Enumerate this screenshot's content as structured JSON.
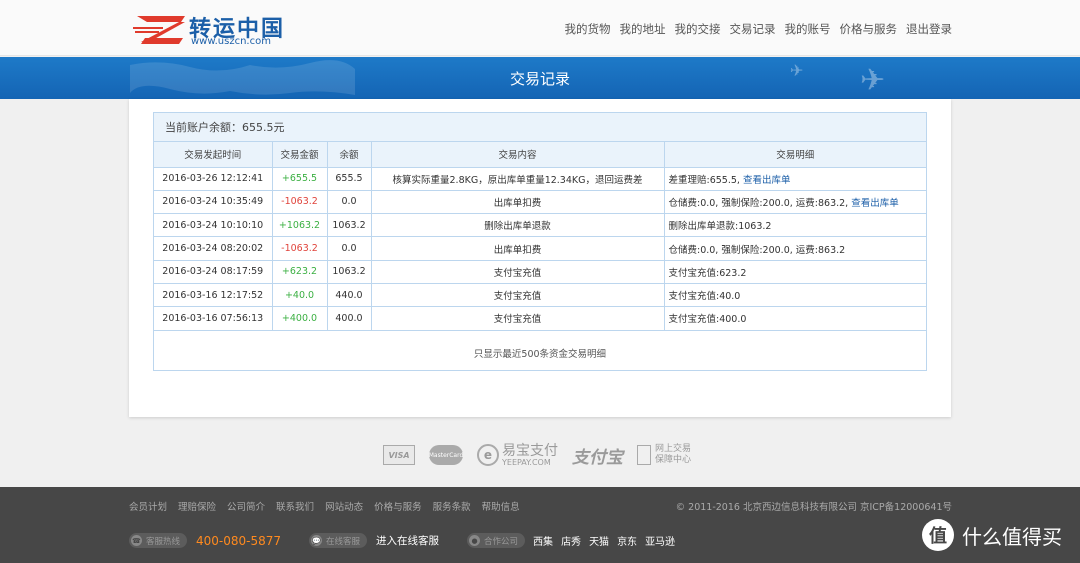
{
  "header": {
    "logo_cn": "转运中国",
    "logo_url": "www.uszcn.com",
    "nav": [
      "我的货物",
      "我的地址",
      "我的交接",
      "交易记录",
      "我的账号",
      "价格与服务",
      "退出登录"
    ]
  },
  "banner": {
    "title": "交易记录"
  },
  "records": {
    "balance": "当前账户余额：655.5元",
    "columns": [
      "交易发起时间",
      "交易金额",
      "余额",
      "交易内容",
      "交易明细"
    ],
    "rows": [
      {
        "time": "2016-03-26 12:12:41",
        "amount": "+655.5",
        "balance": "655.5",
        "content": "核算实际重量2.8KG，原出库单重量12.34KG，退回运费差",
        "detail": "差重理赔:655.5,",
        "link": "查看出库单"
      },
      {
        "time": "2016-03-24 10:35:49",
        "amount": "-1063.2",
        "balance": "0.0",
        "content": "出库单扣费",
        "detail": "仓储费:0.0, 强制保险:200.0, 运费:863.2,",
        "link": "查看出库单"
      },
      {
        "time": "2016-03-24 10:10:10",
        "amount": "+1063.2",
        "balance": "1063.2",
        "content": "删除出库单退款",
        "detail": "删除出库单退款:1063.2",
        "link": ""
      },
      {
        "time": "2016-03-24 08:20:02",
        "amount": "-1063.2",
        "balance": "0.0",
        "content": "出库单扣费",
        "detail": "仓储费:0.0, 强制保险:200.0, 运费:863.2",
        "link": ""
      },
      {
        "time": "2016-03-24 08:17:59",
        "amount": "+623.2",
        "balance": "1063.2",
        "content": "支付宝充值",
        "detail": "支付宝充值:623.2",
        "link": ""
      },
      {
        "time": "2016-03-16 12:17:52",
        "amount": "+40.0",
        "balance": "440.0",
        "content": "支付宝充值",
        "detail": "支付宝充值:40.0",
        "link": ""
      },
      {
        "time": "2016-03-16 07:56:13",
        "amount": "+400.0",
        "balance": "400.0",
        "content": "支付宝充值",
        "detail": "支付宝充值:400.0",
        "link": ""
      }
    ],
    "note": "只显示最近500条资金交易明细"
  },
  "payments": {
    "visa": "VISA",
    "mastercard": "MasterCard",
    "yeepay_cn": "易宝支付",
    "yeepay_en": "YEEPAY.COM",
    "alipay": "支付宝",
    "safe_line1": "网上交易",
    "safe_line2": "保障中心"
  },
  "footer": {
    "links": [
      "会员计划",
      "理赔保险",
      "公司简介",
      "联系我们",
      "网站动态",
      "价格与服务",
      "服务条款",
      "帮助信息"
    ],
    "copyright": "© 2011-2016 北京西边信息科技有限公司 京ICP备12000641号",
    "hotline_label": "客服热线",
    "hotline": "400-080-5877",
    "online_label": "在线客服",
    "online_text": "进入在线客服",
    "partners_label": "合作公司",
    "partners": [
      "西集",
      "店秀",
      "天猫",
      "京东",
      "亚马逊"
    ],
    "watermark": "什么值得买",
    "watermark_icon": "值"
  },
  "colors": {
    "brand_blue": "#1e7ac8",
    "positive": "#3cb043",
    "negative": "#e0443c",
    "phone_orange": "#ff8a1f"
  }
}
